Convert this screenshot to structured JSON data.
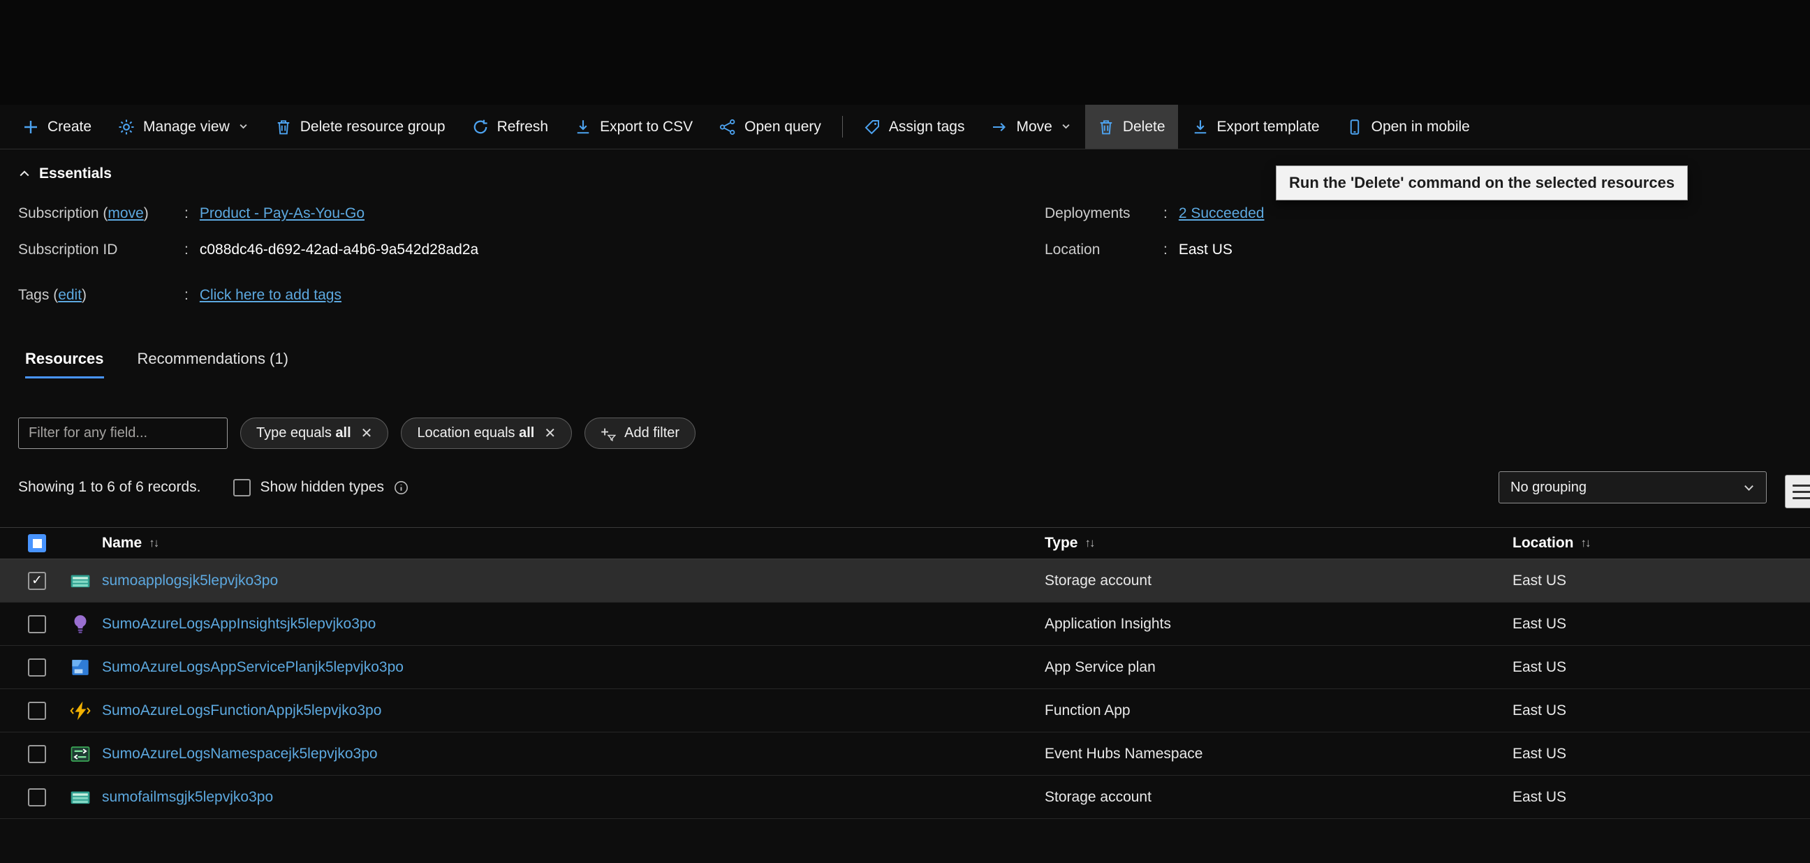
{
  "toolbar": {
    "items": [
      {
        "label": "Create"
      },
      {
        "label": "Manage view"
      },
      {
        "label": "Delete resource group"
      },
      {
        "label": "Refresh"
      },
      {
        "label": "Export to CSV"
      },
      {
        "label": "Open query"
      },
      {
        "label": "Assign tags"
      },
      {
        "label": "Move"
      },
      {
        "label": "Delete"
      },
      {
        "label": "Export template"
      },
      {
        "label": "Open in mobile"
      }
    ],
    "tooltip": "Run the 'Delete' command on the selected resources"
  },
  "essentials": {
    "title": "Essentials",
    "colon": ":",
    "paren_close": ")",
    "subscription_label": "Subscription (",
    "subscription_move": "move",
    "subscription_value": "Product - Pay-As-You-Go",
    "subscription_id_label": "Subscription ID",
    "subscription_id_value": "c088dc46-d692-42ad-a4b6-9a542d28ad2a",
    "tags_label": "Tags (",
    "tags_edit": "edit",
    "tags_value": "Click here to add tags",
    "deployments_label": "Deployments",
    "deployments_value": "2 Succeeded",
    "location_label": "Location",
    "location_value": "East US"
  },
  "tabs": {
    "resources": "Resources",
    "recommendations": "Recommendations (1)"
  },
  "filters": {
    "input_placeholder": "Filter for any field...",
    "pill1_prefix": "Type equals",
    "pill1_value": "all",
    "pill2_prefix": "Location equals",
    "pill2_value": "all",
    "add_filter": "Add filter"
  },
  "status": {
    "records": "Showing 1 to 6 of 6 records.",
    "show_hidden": "Show hidden types",
    "grouping": "No grouping"
  },
  "table": {
    "columns": {
      "name": "Name",
      "type": "Type",
      "location": "Location"
    },
    "rows": [
      {
        "name": "sumoapplogsjk5lepvjko3po",
        "type": "Storage account",
        "location": "East US",
        "icon": "storage-account",
        "checked": true,
        "selected": true
      },
      {
        "name": "SumoAzureLogsAppInsightsjk5lepvjko3po",
        "type": "Application Insights",
        "location": "East US",
        "icon": "application-insights",
        "checked": false
      },
      {
        "name": "SumoAzureLogsAppServicePlanjk5lepvjko3po",
        "type": "App Service plan",
        "location": "East US",
        "icon": "app-service-plan",
        "checked": false
      },
      {
        "name": "SumoAzureLogsFunctionAppjk5lepvjko3po",
        "type": "Function App",
        "location": "East US",
        "icon": "function-app",
        "checked": false
      },
      {
        "name": "SumoAzureLogsNamespacejk5lepvjko3po",
        "type": "Event Hubs Namespace",
        "location": "East US",
        "icon": "event-hubs",
        "checked": false
      },
      {
        "name": "sumofailmsgjk5lepvjko3po",
        "type": "Storage account",
        "location": "East US",
        "icon": "storage-account",
        "checked": false
      }
    ]
  },
  "icons": {
    "sort": "↑↓",
    "close": "✕",
    "check": "✓"
  }
}
